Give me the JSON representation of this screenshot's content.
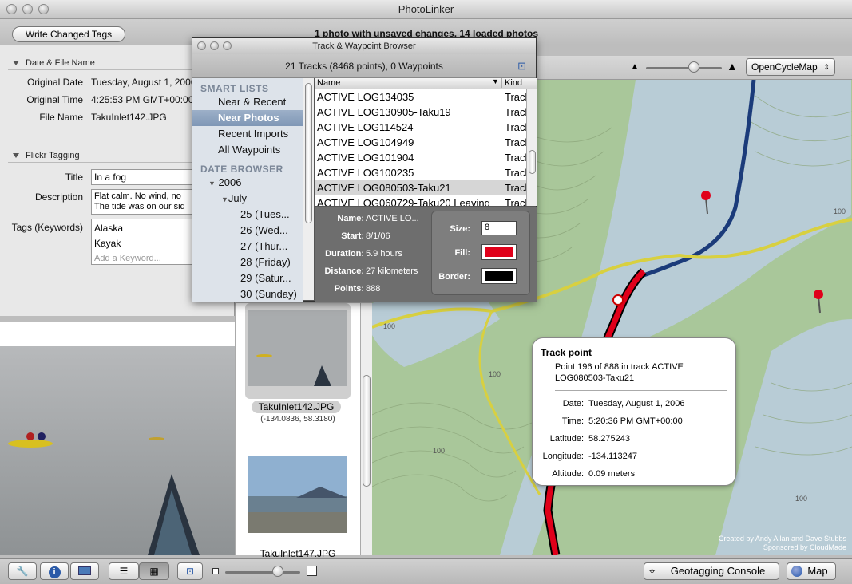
{
  "window": {
    "title": "PhotoLinker"
  },
  "toolbar": {
    "write_tags_label": "Write Changed Tags",
    "status": "1 photo with unsaved changes, 14 loaded photos"
  },
  "date_section": {
    "header": "Date & File Name",
    "original_date_label": "Original Date",
    "original_date": "Tuesday, August 1, 2006",
    "original_time_label": "Original Time",
    "original_time": "4:25:53 PM GMT+00:00",
    "file_name_label": "File Name",
    "file_name": "TakuInlet142.JPG"
  },
  "flickr_section": {
    "header": "Flickr Tagging",
    "title_label": "Title",
    "title_value": "In a fog",
    "description_label": "Description",
    "description_line1": "Flat calm. No wind, no",
    "description_line2": "The tide was on our sid",
    "tags_label": "Tags (Keywords)",
    "tags": [
      "Alaska",
      "Kayak"
    ],
    "tags_placeholder": "Add a Keyword..."
  },
  "thumbnails": [
    {
      "name": "TakuInlet142.JPG",
      "coords": "(-134.0836, 58.3180)"
    },
    {
      "name": "TakuInlet147.JPG",
      "coords": ""
    }
  ],
  "map_controls": {
    "map_type": "OpenCycleMap",
    "credit_line1": "Created by Andy Allan and Dave Stubbs",
    "credit_line2": "Sponsored by CloudMade",
    "contour_labels": [
      "100",
      "100",
      "100",
      "100",
      "100"
    ]
  },
  "browser": {
    "title": "Track & Waypoint Browser",
    "summary": "21 Tracks (8468 points), 0 Waypoints",
    "smart_lists_header": "SMART LISTS",
    "smart_lists": [
      "Near & Recent",
      "Near Photos",
      "Recent Imports",
      "All Waypoints"
    ],
    "selected_smart_list": "Near Photos",
    "date_browser_header": "DATE BROWSER",
    "year": "2006",
    "month": "July",
    "days": [
      "25 (Tues...",
      "26 (Wed...",
      "27 (Thur...",
      "28 (Friday)",
      "29 (Satur...",
      "30 (Sunday)"
    ],
    "col_name": "Name",
    "col_kind": "Kind",
    "tracks": [
      {
        "name": "ACTIVE LOG134035",
        "kind": "Track"
      },
      {
        "name": "ACTIVE LOG130905-Taku19",
        "kind": "Track"
      },
      {
        "name": "ACTIVE LOG114524",
        "kind": "Track"
      },
      {
        "name": "ACTIVE LOG104949",
        "kind": "Track"
      },
      {
        "name": "ACTIVE LOG101904",
        "kind": "Track"
      },
      {
        "name": "ACTIVE LOG100235",
        "kind": "Track"
      },
      {
        "name": "ACTIVE LOG080503-Taku21",
        "kind": "Track"
      },
      {
        "name": "ACTIVE LOG060729-Taku20 Leaving",
        "kind": "Track"
      }
    ],
    "details": {
      "name_label": "Name:",
      "name": "ACTIVE LO...",
      "start_label": "Start:",
      "start": "8/1/06",
      "duration_label": "Duration:",
      "duration": "5.9 hours",
      "distance_label": "Distance:",
      "distance": "27 kilometers",
      "points_label": "Points:",
      "points": "888",
      "size_label": "Size:",
      "size": "8",
      "fill_label": "Fill:",
      "fill_color": "#e0001a",
      "border_label": "Border:",
      "border_color": "#000000"
    }
  },
  "tooltip": {
    "title": "Track point",
    "line1": "Point 196 of 888 in track ACTIVE",
    "line2": "LOG080503-Taku21",
    "date_label": "Date:",
    "date": "Tuesday, August 1, 2006",
    "time_label": "Time:",
    "time": "5:20:36 PM GMT+00:00",
    "latitude_label": "Latitude:",
    "latitude": "58.275243",
    "longitude_label": "Longitude:",
    "longitude": "-134.113247",
    "altitude_label": "Altitude:",
    "altitude": "0.09 meters"
  },
  "bottombar": {
    "geotagging_console_label": "Geotagging Console",
    "map_label": "Map"
  },
  "colors": {
    "track_selected": "#e0001a",
    "track_blue": "#1b3b7a",
    "track_yellow": "#d8d040",
    "water": "#b8ccd6",
    "land": "#a9c79a"
  }
}
